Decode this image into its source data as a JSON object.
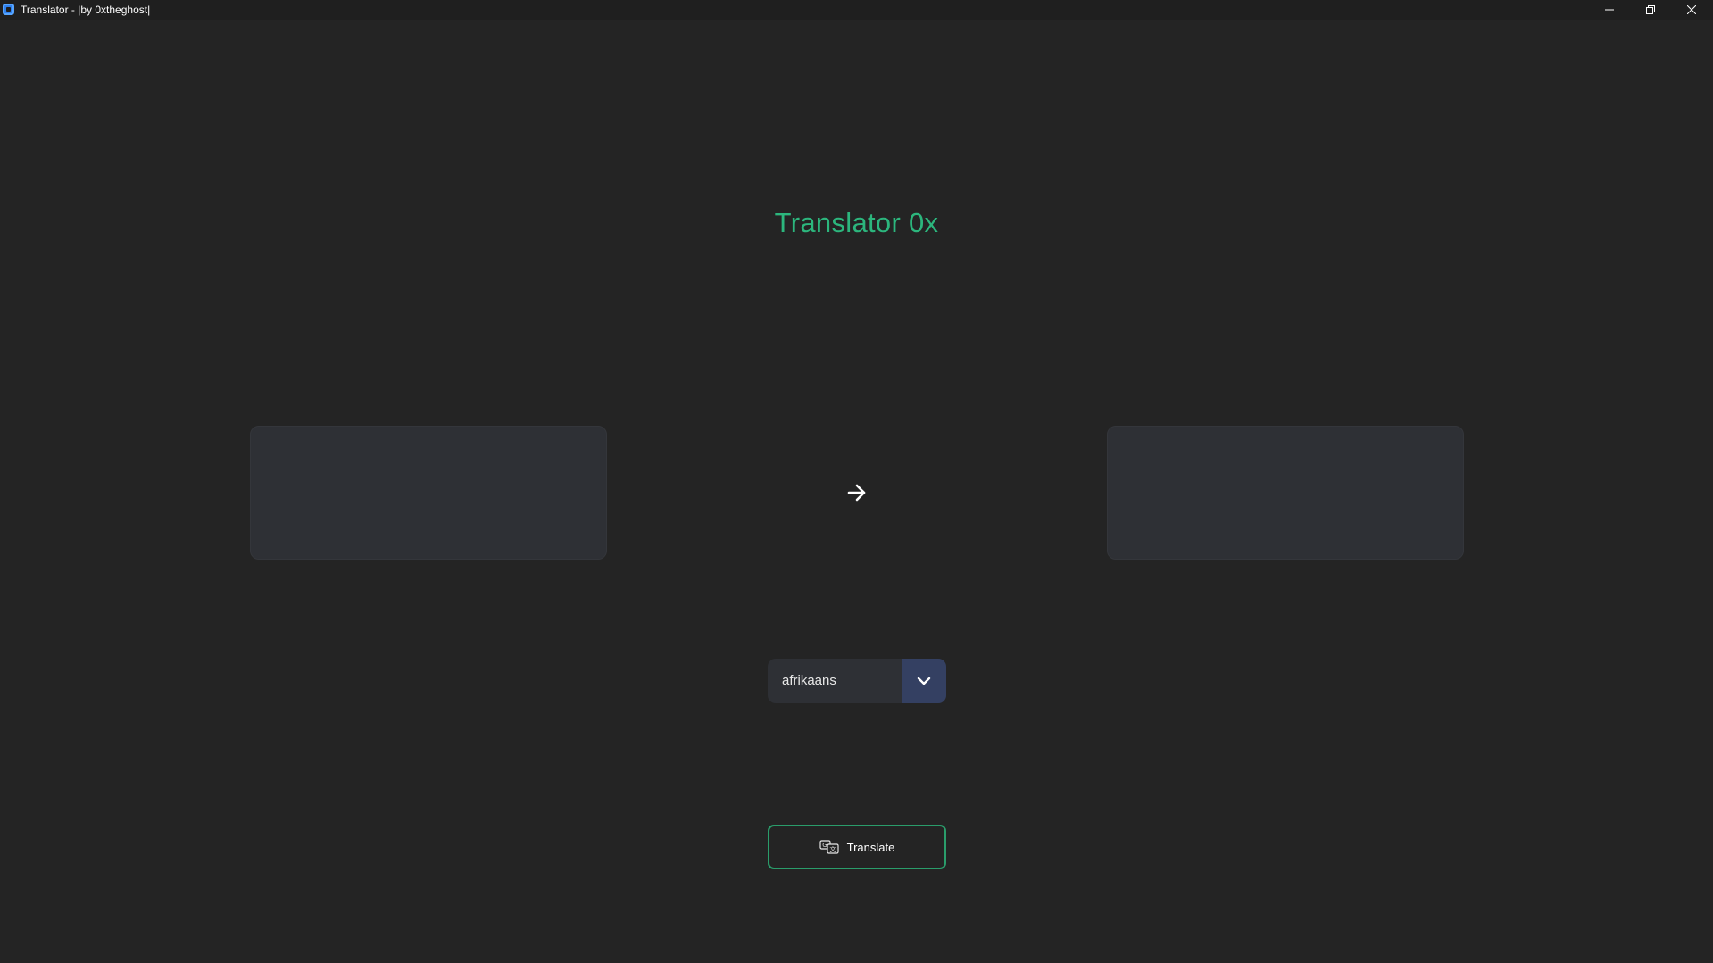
{
  "window": {
    "title": "Translator - |by 0xtheghost|"
  },
  "main": {
    "heading": "Translator 0x",
    "source_text": "",
    "target_text": ""
  },
  "language_select": {
    "selected": "afrikaans"
  },
  "translate_button": {
    "label": "Translate"
  },
  "icons": {
    "app": "app-icon",
    "arrow": "arrow-right-icon",
    "dropdown": "chevron-down-icon",
    "translate": "translate-icon",
    "minimize": "minimize-icon",
    "maximize": "restore-icon",
    "close": "close-icon"
  },
  "colors": {
    "background": "#242424",
    "heading": "#2cb67d",
    "textbox": "#2e3035",
    "dropdown_toggle": "#344062",
    "button_border": "#2a9d6b"
  }
}
